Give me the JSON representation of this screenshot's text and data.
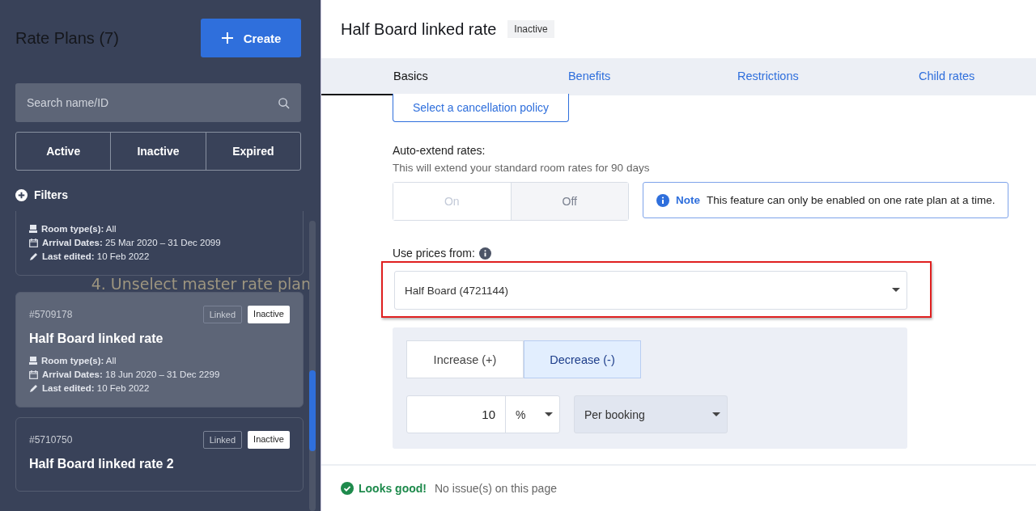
{
  "sidebar": {
    "title": "Rate Plans (7)",
    "create_button": "Create",
    "search": {
      "placeholder": "Search name/ID"
    },
    "status_tabs": [
      {
        "label": "Active",
        "selected": false
      },
      {
        "label": "Inactive",
        "selected": false
      },
      {
        "label": "Expired",
        "selected": false
      }
    ],
    "filters": "Filters",
    "cards": [
      {
        "selected": false,
        "details": [
          {
            "kind": "room",
            "label": "Room type(s):",
            "value": "All"
          },
          {
            "kind": "dates",
            "label": "Arrival Dates:",
            "value": "25 Mar 2020 – 31 Dec 2099"
          },
          {
            "kind": "edited",
            "label": "Last edited:",
            "value": "10 Feb 2022"
          }
        ]
      },
      {
        "id": "#5709178",
        "title": "Half Board linked rate",
        "selected": true,
        "badges": [
          {
            "label": "Linked",
            "kind": "outline"
          },
          {
            "label": "Inactive",
            "kind": "solid"
          }
        ],
        "details": [
          {
            "kind": "room",
            "label": "Room type(s):",
            "value": "All"
          },
          {
            "kind": "dates",
            "label": "Arrival Dates:",
            "value": "18 Jun 2020 – 31 Dec 2299"
          },
          {
            "kind": "edited",
            "label": "Last edited:",
            "value": "10 Feb 2022"
          }
        ]
      },
      {
        "id": "#5710750",
        "title": "Half Board linked rate 2",
        "selected": false,
        "badges": [
          {
            "label": "Linked",
            "kind": "outline"
          },
          {
            "label": "Inactive",
            "kind": "solid"
          }
        ]
      }
    ],
    "annotation": "4. Unselect master rate plan"
  },
  "main": {
    "title": "Half Board linked rate",
    "status": "Inactive",
    "tabs": [
      {
        "label": "Basics",
        "selected": true
      },
      {
        "label": "Benefits",
        "selected": false
      },
      {
        "label": "Restrictions",
        "selected": false
      },
      {
        "label": "Child rates",
        "selected": false
      }
    ],
    "cancellation_button": "Select a cancellation policy",
    "auto_extend": {
      "label": "Auto-extend rates:",
      "description": "This will extend your standard room rates for 90 days",
      "options": [
        {
          "label": "On",
          "selected": false
        },
        {
          "label": "Off",
          "selected": true
        }
      ],
      "note_title": "Note",
      "note_text": "This feature can only be enabled on one rate plan at a time."
    },
    "prices": {
      "label": "Use prices from:",
      "value": "Half Board (4721144)",
      "highlighted": true,
      "direction": [
        {
          "label": "Increase (+)",
          "selected": false
        },
        {
          "label": "Decrease (-)",
          "selected": true
        }
      ],
      "amount": "10",
      "unit": "%",
      "per": "Per booking"
    },
    "footer": {
      "status": "Looks good!",
      "message": "No issue(s) on this page"
    }
  }
}
